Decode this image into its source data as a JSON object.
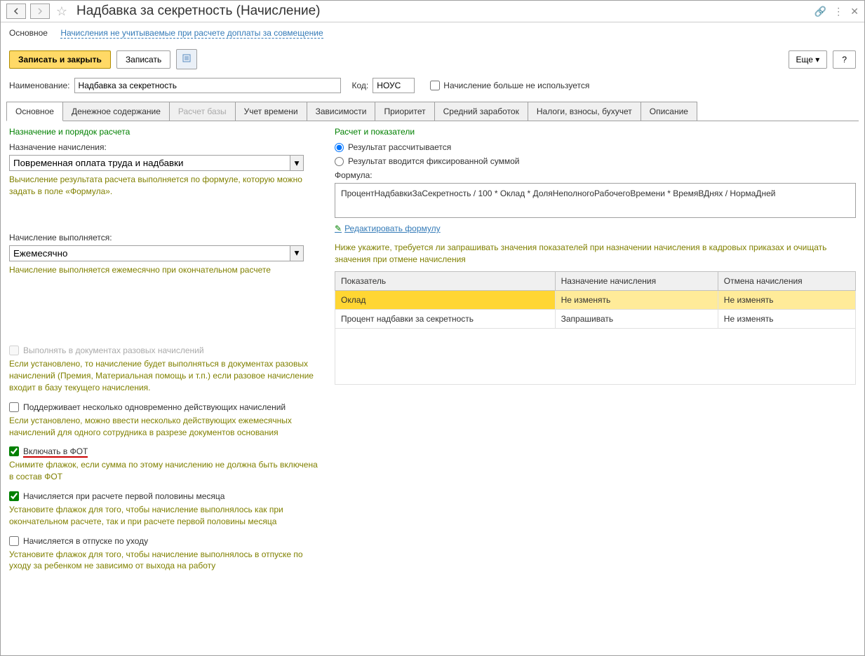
{
  "window": {
    "title": "Надбавка за секретность (Начисление)"
  },
  "top_nav": {
    "main": "Основное",
    "link": "Начисления не учитываемые при расчете доплаты за совмещение"
  },
  "toolbar": {
    "save_close": "Записать и закрыть",
    "save": "Записать",
    "more": "Еще",
    "help": "?"
  },
  "form": {
    "name_label": "Наименование:",
    "name_value": "Надбавка за секретность",
    "code_label": "Код:",
    "code_value": "НОУС",
    "not_used_label": "Начисление больше не используется"
  },
  "tabs": {
    "t1": "Основное",
    "t2": "Денежное содержание",
    "t3": "Расчет базы",
    "t4": "Учет времени",
    "t5": "Зависимости",
    "t6": "Приоритет",
    "t7": "Средний заработок",
    "t8": "Налоги, взносы, бухучет",
    "t9": "Описание"
  },
  "left": {
    "section_title": "Назначение и порядок расчета",
    "purpose_label": "Назначение начисления:",
    "purpose_value": "Повременная оплата труда и надбавки",
    "purpose_hint": "Вычисление результата расчета выполняется по формуле, которую можно задать в поле «Формула».",
    "exec_label": "Начисление выполняется:",
    "exec_value": "Ежемесячно",
    "exec_hint": "Начисление выполняется ежемесячно при окончательном расчете",
    "cb1_label": "Выполнять в документах разовых начислений",
    "cb1_hint": "Если установлено, то начисление будет выполняться в документах разовых начислений (Премия, Материальная помощь и т.п.) если разовое начисление входит в базу текущего начисления.",
    "cb2_label": "Поддерживает несколько одновременно действующих начислений",
    "cb2_hint": "Если установлено, можно ввести несколько действующих ежемесячных начислений для одного сотрудника в разрезе документов основания",
    "cb3_label": "Включать в ФОТ",
    "cb3_hint": "Снимите флажок, если сумма по этому начислению не должна быть включена в состав ФОТ",
    "cb4_label": "Начисляется при расчете первой половины месяца",
    "cb4_hint": "Установите флажок для того, чтобы начисление выполнялось как при окончательном расчете, так и при расчете первой половины месяца",
    "cb5_label": "Начисляется в отпуске по уходу",
    "cb5_hint": "Установите флажок для того, чтобы начисление выполнялось в отпуске по уходу за ребенком не зависимо от выхода на работу"
  },
  "right": {
    "section_title": "Расчет и показатели",
    "radio1": "Результат рассчитывается",
    "radio2": "Результат вводится фиксированной суммой",
    "formula_label": "Формула:",
    "formula_value": "ПроцентНадбавкиЗаСекретность / 100 * Оклад * ДоляНеполногоРабочегоВремени * ВремяВДнях / НормаДней",
    "edit_link": "Редактировать формулу",
    "table_hint": "Ниже укажите, требуется ли запрашивать значения показателей при назначении начисления в кадровых приказах и очищать значения при отмене начисления",
    "th1": "Показатель",
    "th2": "Назначение начисления",
    "th3": "Отмена начисления",
    "rows": [
      {
        "c1": "Оклад",
        "c2": "Не изменять",
        "c3": "Не изменять"
      },
      {
        "c1": "Процент надбавки за секретность",
        "c2": "Запрашивать",
        "c3": "Не изменять"
      }
    ]
  }
}
